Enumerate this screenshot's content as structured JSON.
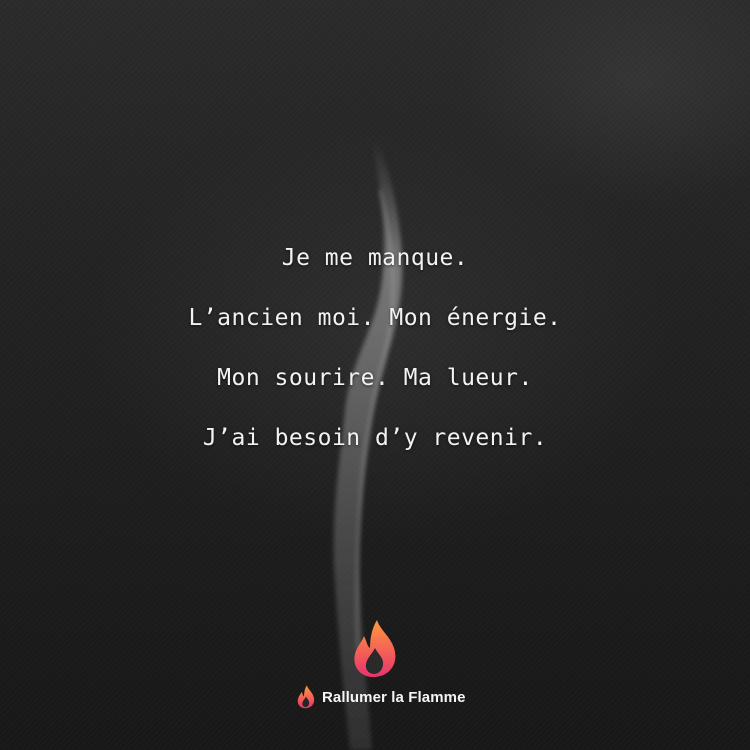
{
  "quote": {
    "lines": [
      "Je me manque.",
      "L’ancien moi. Mon énergie.",
      "Mon sourire. Ma lueur.",
      "J’ai besoin d’y revenir."
    ]
  },
  "brand": {
    "name": "Rallumer la Flamme",
    "icon": "flame-icon",
    "colors": {
      "flame_top": "#ff8a3c",
      "flame_bottom": "#e8336d"
    }
  }
}
